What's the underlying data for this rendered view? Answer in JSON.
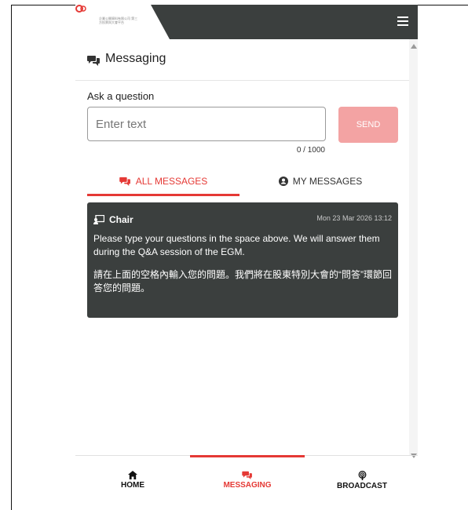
{
  "header": {
    "logo_text": "企業公開資料有限公司\n第三方投票與大會平台"
  },
  "section": {
    "title": "Messaging"
  },
  "ask": {
    "label": "Ask a question",
    "placeholder": "Enter text",
    "value": "",
    "send_label": "SEND",
    "counter": "0 / 1000"
  },
  "tabs": [
    {
      "label": "ALL MESSAGES",
      "active": true
    },
    {
      "label": "MY MESSAGES",
      "active": false
    }
  ],
  "messages": [
    {
      "author": "Chair",
      "time": "Mon 23 Mar 2026 13:12",
      "body_en": "Please type your questions in the space above.  We will answer them during the Q&A session of the EGM.",
      "body_zh": "請在上面的空格內輸入您的問題。我們將在股東特別大會的“問答”環節回答您的問題。"
    }
  ],
  "nav": {
    "home": "HOME",
    "messaging": "MESSAGING",
    "broadcast": "BROADCAST"
  },
  "colors": {
    "accent": "#e53935",
    "header_bg": "#3b3f3e",
    "send_disabled": "#f3a3a3"
  }
}
